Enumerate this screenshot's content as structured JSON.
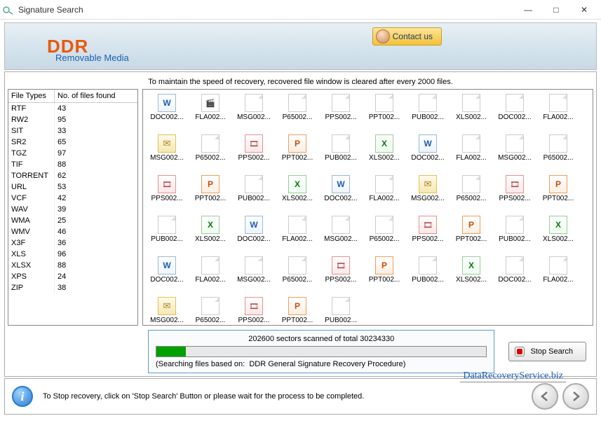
{
  "window": {
    "title": "Signature Search",
    "minimize": "—",
    "maximize": "□",
    "close": "✕"
  },
  "banner": {
    "logo_main": "DDR",
    "logo_sub": "Removable Media",
    "contact_label": "Contact us"
  },
  "notice": "To maintain the speed of recovery, recovered file window is cleared after every 2000 files.",
  "table": {
    "col1": "File Types",
    "col2": "No. of files found",
    "rows": [
      {
        "t": "RTF",
        "n": "43"
      },
      {
        "t": "RW2",
        "n": "95"
      },
      {
        "t": "SIT",
        "n": "33"
      },
      {
        "t": "SR2",
        "n": "65"
      },
      {
        "t": "TGZ",
        "n": "97"
      },
      {
        "t": "TIF",
        "n": "88"
      },
      {
        "t": "TORRENT",
        "n": "62"
      },
      {
        "t": "URL",
        "n": "53"
      },
      {
        "t": "VCF",
        "n": "42"
      },
      {
        "t": "WAV",
        "n": "39"
      },
      {
        "t": "WMA",
        "n": "25"
      },
      {
        "t": "WMV",
        "n": "46"
      },
      {
        "t": "X3F",
        "n": "36"
      },
      {
        "t": "XLS",
        "n": "96"
      },
      {
        "t": "XLSX",
        "n": "88"
      },
      {
        "t": "XPS",
        "n": "24"
      },
      {
        "t": "ZIP",
        "n": "38"
      }
    ]
  },
  "files": [
    {
      "n": "DOC002...",
      "k": "doc"
    },
    {
      "n": "FLA002...",
      "k": "fla"
    },
    {
      "n": "MSG002...",
      "k": "gen"
    },
    {
      "n": "P65002...",
      "k": "gen"
    },
    {
      "n": "PPS002...",
      "k": "gen"
    },
    {
      "n": "PPT002...",
      "k": "gen"
    },
    {
      "n": "PUB002...",
      "k": "gen"
    },
    {
      "n": "XLS002...",
      "k": "gen"
    },
    {
      "n": "DOC002...",
      "k": "gen"
    },
    {
      "n": "FLA002...",
      "k": "gen"
    },
    {
      "n": "MSG002...",
      "k": "msg"
    },
    {
      "n": "P65002...",
      "k": "gen"
    },
    {
      "n": "PPS002...",
      "k": "pps"
    },
    {
      "n": "PPT002...",
      "k": "ppt"
    },
    {
      "n": "PUB002...",
      "k": "gen"
    },
    {
      "n": "XLS002...",
      "k": "xls"
    },
    {
      "n": "DOC002...",
      "k": "doc"
    },
    {
      "n": "FLA002...",
      "k": "gen"
    },
    {
      "n": "MSG002...",
      "k": "gen"
    },
    {
      "n": "P65002...",
      "k": "gen"
    },
    {
      "n": "PPS002...",
      "k": "pps"
    },
    {
      "n": "PPT002...",
      "k": "ppt"
    },
    {
      "n": "PUB002...",
      "k": "gen"
    },
    {
      "n": "XLS002...",
      "k": "xls"
    },
    {
      "n": "DOC002...",
      "k": "doc"
    },
    {
      "n": "FLA002...",
      "k": "gen"
    },
    {
      "n": "MSG002...",
      "k": "msg"
    },
    {
      "n": "P65002...",
      "k": "gen"
    },
    {
      "n": "PPS002...",
      "k": "pps"
    },
    {
      "n": "PPT002...",
      "k": "ppt"
    },
    {
      "n": "PUB002...",
      "k": "gen"
    },
    {
      "n": "XLS002...",
      "k": "xls"
    },
    {
      "n": "DOC002...",
      "k": "doc"
    },
    {
      "n": "FLA002...",
      "k": "gen"
    },
    {
      "n": "MSG002...",
      "k": "gen"
    },
    {
      "n": "P65002...",
      "k": "gen"
    },
    {
      "n": "PPS002...",
      "k": "pps"
    },
    {
      "n": "PPT002...",
      "k": "ppt"
    },
    {
      "n": "PUB002...",
      "k": "gen"
    },
    {
      "n": "XLS002...",
      "k": "xls"
    },
    {
      "n": "DOC002...",
      "k": "doc"
    },
    {
      "n": "FLA002...",
      "k": "gen"
    },
    {
      "n": "MSG002...",
      "k": "gen"
    },
    {
      "n": "P65002...",
      "k": "gen"
    },
    {
      "n": "PPS002...",
      "k": "pps"
    },
    {
      "n": "PPT002...",
      "k": "ppt"
    },
    {
      "n": "PUB002...",
      "k": "gen"
    },
    {
      "n": "XLS002...",
      "k": "xls"
    },
    {
      "n": "DOC002...",
      "k": "gen"
    },
    {
      "n": "FLA002...",
      "k": "gen"
    },
    {
      "n": "MSG002...",
      "k": "msg"
    },
    {
      "n": "P65002...",
      "k": "gen"
    },
    {
      "n": "PPS002...",
      "k": "pps"
    },
    {
      "n": "PPT002...",
      "k": "ppt"
    },
    {
      "n": "PUB002...",
      "k": "gen"
    }
  ],
  "progress": {
    "scanned": "202600",
    "total": "30234330",
    "label_pre": "sectors scanned of total",
    "pct": 9,
    "method_pre": "(Searching files based on:",
    "method": "DDR General Signature Recovery Procedure)",
    "stop_label": "Stop Search"
  },
  "footer": {
    "tip": "To Stop recovery, click on 'Stop Search' Button or please wait for the process to be completed."
  },
  "watermark": "DataRecoveryService.biz"
}
